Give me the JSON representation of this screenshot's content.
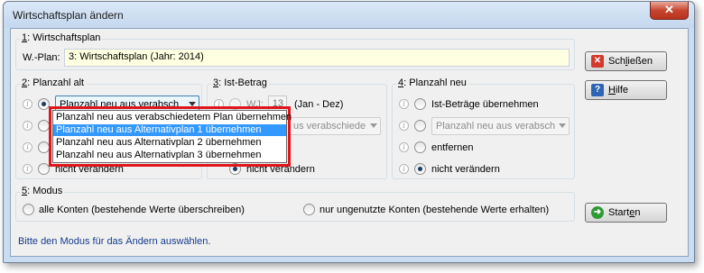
{
  "window": {
    "title": "Wirtschaftsplan ändern",
    "close_glyph": "✕"
  },
  "group1": {
    "label_num": "1",
    "label_rest": ": Wirtschaftsplan",
    "field_label": "W.-Plan:",
    "field_value": "3: Wirtschaftsplan (Jahr: 2014)"
  },
  "group2": {
    "label_num": "2",
    "label_rest": ": Planzahl alt",
    "combo_value": "Planzahl neu aus verabsch",
    "hidden_option": "nicht verändern",
    "dropdown_options": [
      "Planzahl neu aus verabschiedetem Plan übernehmen",
      "Planzahl neu aus Alternativplan 1 übernehmen",
      "Planzahl neu aus Alternativplan 2 übernehmen",
      "Planzahl neu aus Alternativplan 3 übernehmen"
    ],
    "selected_index": 1
  },
  "group3": {
    "label_num": "3",
    "label_rest": ": Ist-Betrag",
    "wj_label": "WJ:",
    "wj_value": "13",
    "wj_range": "(Jan - Dez)",
    "combo_value": "us verabschiede",
    "nochange": "nicht verändern"
  },
  "group4": {
    "label_num": "4",
    "label_rest": ": Planzahl neu",
    "opt_ist": "Ist-Beträge übernehmen",
    "combo_value": "Planzahl neu aus verabsch",
    "opt_remove": "entfernen",
    "opt_nochange": "nicht verändern"
  },
  "group5": {
    "label_num": "5",
    "label_rest": ": Modus",
    "opt_all": "alle Konten (bestehende Werte überschreiben)",
    "opt_unused": "nur ungenutzte Konten (bestehende Werte erhalten)"
  },
  "buttons": {
    "close_pre": "Sch",
    "close_u": "l",
    "close_post": "ießen",
    "help_u": "H",
    "help_post": "ilfe",
    "start_pre": "Start",
    "start_u": "e",
    "start_post": "n"
  },
  "status_text": "Bitte den Modus für das Ändern auswählen.",
  "colors": {
    "highlight_border": "#e0161b",
    "selection": "#3399ff",
    "status_text": "#143c8c"
  },
  "icons": {
    "close": "red-x-icon",
    "help": "question-icon",
    "start": "green-arrow-icon",
    "info": "info-icon"
  }
}
